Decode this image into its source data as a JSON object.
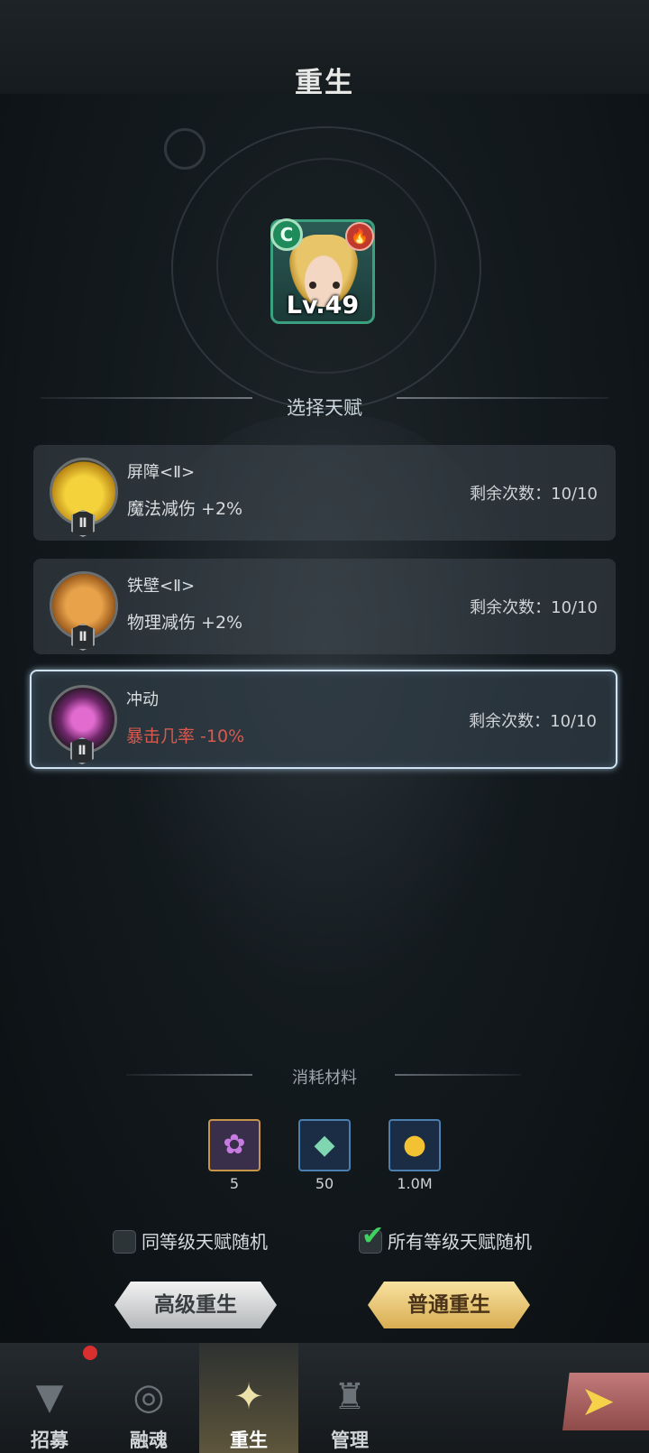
{
  "header": {
    "title": "重生"
  },
  "hero": {
    "level": "Lv.49",
    "grade": "C"
  },
  "subtitle": "选择天赋",
  "talents": [
    {
      "name": "屏障<Ⅱ>",
      "effect": "魔法减伤 +2%",
      "remaining": "剩余次数：10/10",
      "tier": "Ⅱ",
      "icon": "barrier-icon"
    },
    {
      "name": "铁壁<Ⅱ>",
      "effect": "物理减伤 +2%",
      "remaining": "剩余次数：10/10",
      "tier": "Ⅱ",
      "icon": "iron-wall-icon"
    },
    {
      "name": "冲动",
      "effect": "暴击几率 -10%",
      "remaining": "剩余次数：10/10",
      "tier": "Ⅱ",
      "icon": "impulse-icon"
    }
  ],
  "materials": {
    "header": "消耗材料",
    "items": [
      {
        "icon": "soul-flower-icon",
        "count": "5"
      },
      {
        "icon": "crystal-icon",
        "count": "50"
      },
      {
        "icon": "gold-coin-icon",
        "count": "1.0M"
      }
    ]
  },
  "options": {
    "same_level_random": {
      "label": "同等级天赋随机",
      "checked": false
    },
    "all_level_random": {
      "label": "所有等级天赋随机",
      "checked": true
    }
  },
  "buttons": {
    "advanced": "高级重生",
    "normal": "普通重生"
  },
  "nav": {
    "tabs": [
      {
        "label": "招募",
        "icon": "recruit-icon",
        "active": false
      },
      {
        "label": "融魂",
        "icon": "soul-fusion-icon",
        "active": false
      },
      {
        "label": "重生",
        "icon": "rebirth-icon",
        "active": true
      },
      {
        "label": "管理",
        "icon": "manage-icon",
        "active": false
      }
    ]
  },
  "colors": {
    "selected_border": "#cfe3f4",
    "negative_text": "#d9594e",
    "grade_badge": "#1f8a5a"
  }
}
